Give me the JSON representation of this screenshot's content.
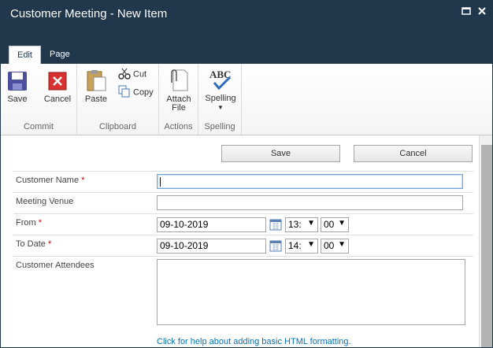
{
  "window": {
    "title": "Customer Meeting - New Item",
    "tabs": [
      {
        "label": "Edit"
      },
      {
        "label": "Page"
      }
    ]
  },
  "ribbon": {
    "groups": [
      {
        "label": "Commit",
        "buttons": [
          "Save",
          "Cancel"
        ]
      },
      {
        "label": "Clipboard",
        "buttons": [
          "Paste",
          "Cut",
          "Copy"
        ]
      },
      {
        "label": "Actions",
        "buttons": [
          "Attach File"
        ]
      },
      {
        "label": "Spelling",
        "buttons": [
          "Spelling"
        ]
      }
    ],
    "save": "Save",
    "cancel": "Cancel",
    "paste": "Paste",
    "cut": "Cut",
    "copy": "Copy",
    "attach_line1": "Attach",
    "attach_line2": "File",
    "spelling": "Spelling",
    "spelling_icon_text": "ABC"
  },
  "form": {
    "save_button": "Save",
    "cancel_button": "Cancel",
    "required_marker": "*",
    "fields": {
      "customer_name": {
        "label": "Customer Name",
        "value": ""
      },
      "meeting_venue": {
        "label": "Meeting Venue",
        "value": ""
      },
      "from": {
        "label": "From",
        "date": "09-10-2019",
        "hour": "13:",
        "minute": "00"
      },
      "to_date": {
        "label": "To Date",
        "date": "09-10-2019",
        "hour": "14:",
        "minute": "00"
      },
      "customer_attendees": {
        "label": "Customer Attendees",
        "value": ""
      }
    },
    "help_link": "Click for help about adding basic HTML formatting."
  },
  "colors": {
    "title_bar": "#21374c",
    "required": "#bf0000",
    "link": "#0072bc"
  }
}
